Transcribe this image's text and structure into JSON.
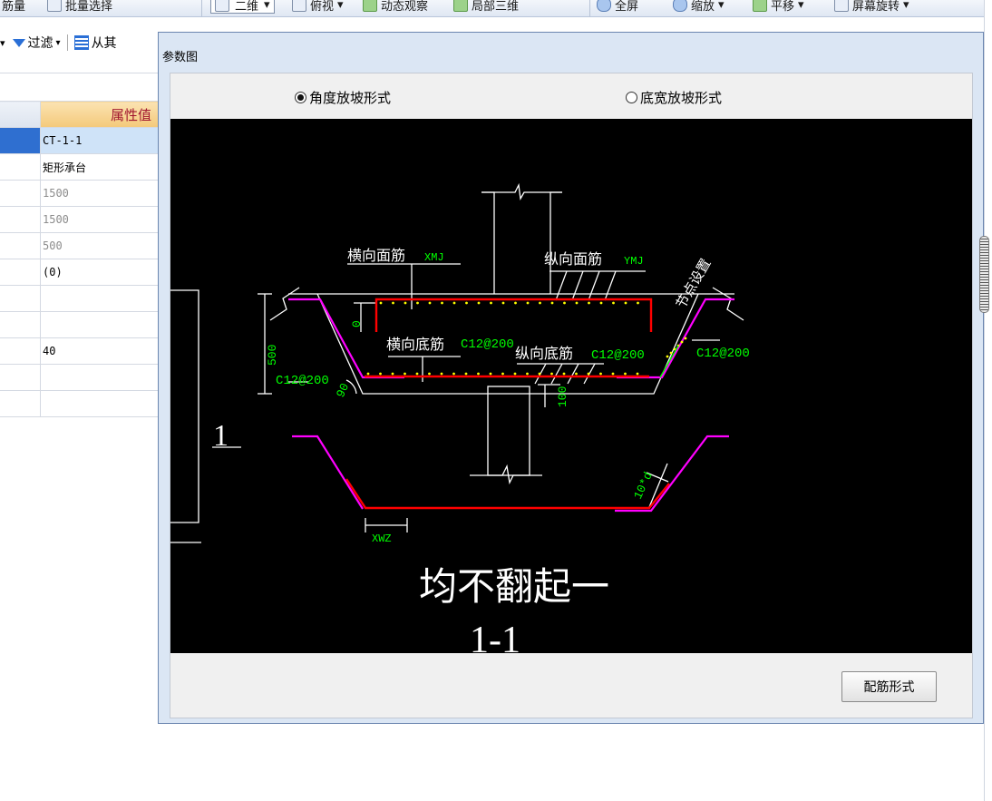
{
  "toolbar": {
    "items": [
      "筋量",
      "批量选择",
      "二维",
      "俯视",
      "动态观察",
      "局部三维",
      "全屏",
      "缩放",
      "平移",
      "屏幕旋转"
    ]
  },
  "toolbar2": {
    "filter_label": "过滤",
    "from_label": "从其"
  },
  "prop_table": {
    "header": "属性值",
    "rows": [
      "CT-1-1",
      "矩形承台",
      "1500",
      "1500",
      "500",
      "(0)",
      "",
      "",
      "40",
      "",
      ""
    ]
  },
  "dialog": {
    "title": "参数图",
    "radio_angle": "角度放坡形式",
    "radio_width": "底宽放坡形式",
    "rebar_button": "配筋形式"
  },
  "drawing": {
    "left_marker": "1",
    "label_xmj": "横向面筋",
    "code_xmj": "XMJ",
    "label_ymj": "纵向面筋",
    "code_ymj": "YMJ",
    "label_node": "节点设置",
    "label_xdj": "横向底筋",
    "spec_xdj": "C12@200",
    "label_ydj": "纵向底筋",
    "spec_ydj": "C12@200",
    "spec_right": "C12@200",
    "spec_left": "C12@200",
    "dim_500": "500",
    "dim_0": "0",
    "dim_90": "90",
    "dim_100": "100",
    "dim_10d": "10*d",
    "code_xwz": "XWZ",
    "caption": "均不翻起一",
    "section": "1-1"
  },
  "colors": {
    "rebar_red": "#ff0000",
    "rebar_magenta": "#ff00ff",
    "dim_green": "#00ff00",
    "node_yellow": "#ffff00",
    "line_white": "#ffffff",
    "highlight_blue": "#2f6fd0"
  }
}
